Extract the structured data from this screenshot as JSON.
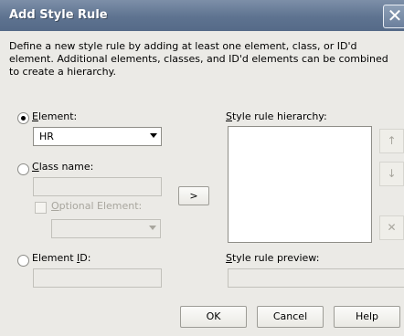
{
  "dialog": {
    "title": "Add Style Rule",
    "close_glyph": "✕",
    "description": "Define a new style rule by adding at least one element, class, or ID'd element. Additional elements, classes, and ID'd elements can be combined to create a hierarchy."
  },
  "element_option": {
    "label_first": "E",
    "label_rest": "lement:",
    "selected": true,
    "value": "HR"
  },
  "class_option": {
    "label_first": "C",
    "label_rest": "lass name:",
    "selected": false,
    "value": ""
  },
  "optional_element": {
    "label_first": "O",
    "label_rest": "ptional Element:",
    "checked": false,
    "value": ""
  },
  "id_option": {
    "label_prefix": "Element ",
    "label_accel": "I",
    "label_rest": "D:",
    "selected": false,
    "value": ""
  },
  "add_button": {
    "label": ">"
  },
  "hierarchy": {
    "label_first": "S",
    "label_rest": "tyle rule hierarchy:",
    "items": []
  },
  "preview": {
    "label_first": "S",
    "label_rest": "tyle rule preview:",
    "value": ""
  },
  "side_buttons": {
    "move_up": "↑",
    "move_down": "↓",
    "delete": "✕"
  },
  "footer": {
    "ok": "OK",
    "cancel": "Cancel",
    "help": "Help"
  },
  "colors": {
    "titlebar": "#5e7390",
    "dialog_bg": "#ebeae6",
    "disabled_text": "#a8a69e"
  }
}
